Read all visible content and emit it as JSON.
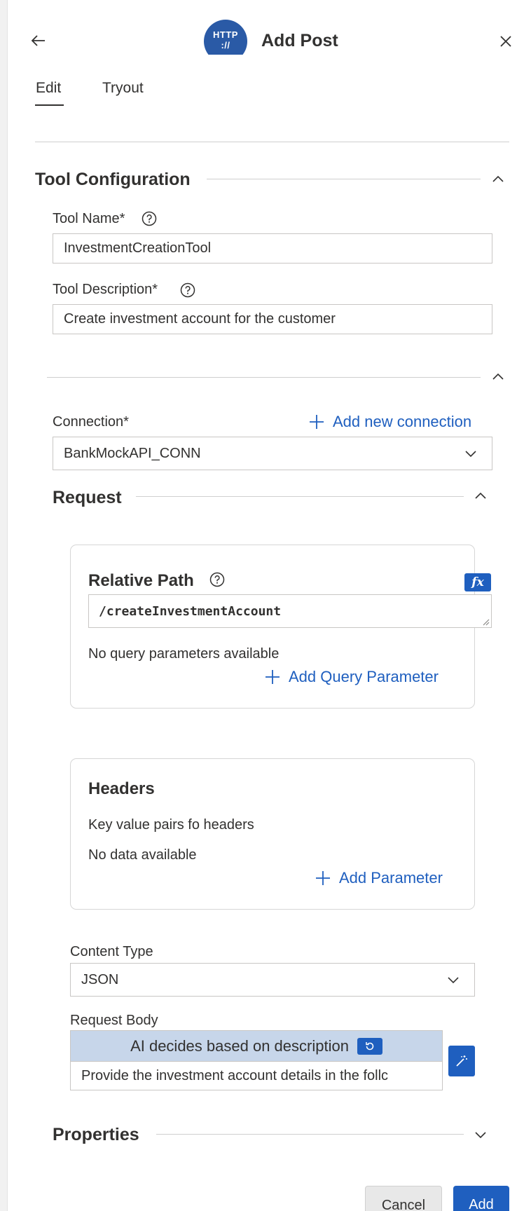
{
  "header": {
    "title": "Add Post",
    "logo_text_top": "HTTP",
    "logo_text_bottom": "://",
    "back_icon": "arrow-left-icon",
    "close_icon": "close-icon"
  },
  "tabs": [
    {
      "label": "Edit",
      "active": true
    },
    {
      "label": "Tryout",
      "active": false
    }
  ],
  "tool_configuration": {
    "title": "Tool Configuration",
    "expanded": true,
    "tool_name_label": "Tool Name*",
    "tool_name_value": "InvestmentCreationTool",
    "tool_description_label": "Tool Description*",
    "tool_description_value": "Create investment account for the customer"
  },
  "connection": {
    "section_expanded": true,
    "label": "Connection*",
    "add_link": "Add new connection",
    "selected": "BankMockAPI_CONN"
  },
  "request": {
    "title": "Request",
    "expanded": true,
    "relative_path": {
      "title": "Relative Path",
      "fx_label": "fx",
      "value": "/createInvestmentAccount",
      "no_query_text": "No query parameters available",
      "add_query_link": "Add Query Parameter"
    },
    "headers": {
      "title": "Headers",
      "description": "Key value pairs fo headers",
      "no_data_text": "No data available",
      "add_param_link": "Add Parameter"
    },
    "content_type": {
      "label": "Content Type",
      "selected": "JSON"
    },
    "request_body": {
      "label": "Request Body",
      "ai_banner": "AI decides based on description",
      "value": "Provide the investment account details in the follc"
    }
  },
  "properties": {
    "title": "Properties",
    "expanded": false
  },
  "footer": {
    "cancel_label": "Cancel",
    "add_label": "Add"
  },
  "colors": {
    "accent": "#1f5fbf",
    "ai_banner_bg": "#c7d6ea",
    "logo_bg": "#2a5aa6"
  }
}
